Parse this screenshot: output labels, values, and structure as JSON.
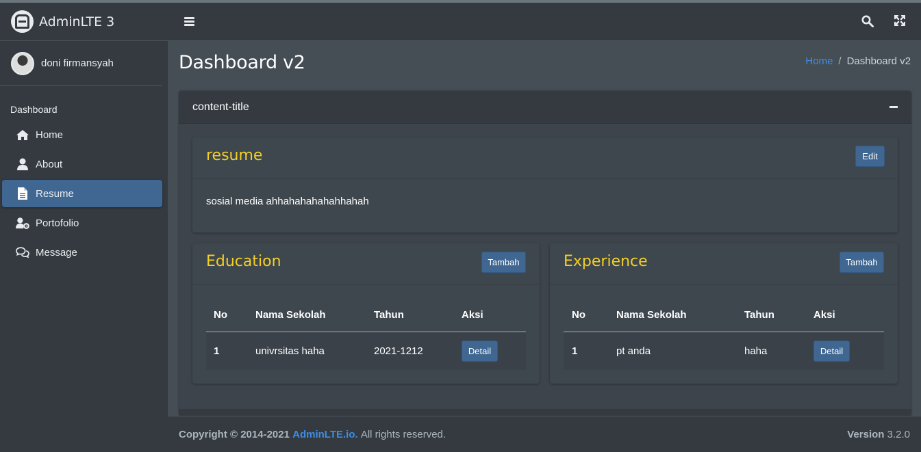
{
  "brand": {
    "name": "AdminLTE 3",
    "logo_icon": "adminlte-logo-icon"
  },
  "user": {
    "name": "doni firmansyah"
  },
  "sidebar": {
    "header": "Dashboard",
    "items": [
      {
        "label": "Home",
        "icon": "home-icon"
      },
      {
        "label": "About",
        "icon": "user-icon"
      },
      {
        "label": "Resume",
        "icon": "file-icon",
        "active": true
      },
      {
        "label": "Portofolio",
        "icon": "user-cog-icon"
      },
      {
        "label": "Message",
        "icon": "comments-icon"
      }
    ]
  },
  "page": {
    "title": "Dashboard v2",
    "breadcrumb": {
      "home": "Home",
      "sep": "/",
      "current": "Dashboard v2"
    }
  },
  "main_card": {
    "title": "content-title"
  },
  "resume": {
    "title": "resume",
    "edit_label": "Edit",
    "text": "sosial media ahhahahahahahhahah"
  },
  "education": {
    "title": "Education",
    "add_label": "Tambah",
    "columns": [
      "No",
      "Nama Sekolah",
      "Tahun",
      "Aksi"
    ],
    "rows": [
      {
        "no": "1",
        "name": "univrsitas haha",
        "year": "2021-1212",
        "action": "Detail"
      }
    ]
  },
  "experience": {
    "title": "Experience",
    "add_label": "Tambah",
    "columns": [
      "No",
      "Nama Sekolah",
      "Tahun",
      "Aksi"
    ],
    "rows": [
      {
        "no": "1",
        "name": "pt anda",
        "year": "haha",
        "action": "Detail"
      }
    ]
  },
  "footer": {
    "copyright": "Copyright © 2014-2021",
    "link": "AdminLTE.io.",
    "rights": "All rights reserved.",
    "version_label": "Version",
    "version": "3.2.0"
  },
  "colors": {
    "accent": "#3f6791",
    "title_yellow": "#f4d022",
    "link_blue": "#3f8de4",
    "sidebar_bg": "#343a40",
    "content_bg": "#454d55"
  }
}
